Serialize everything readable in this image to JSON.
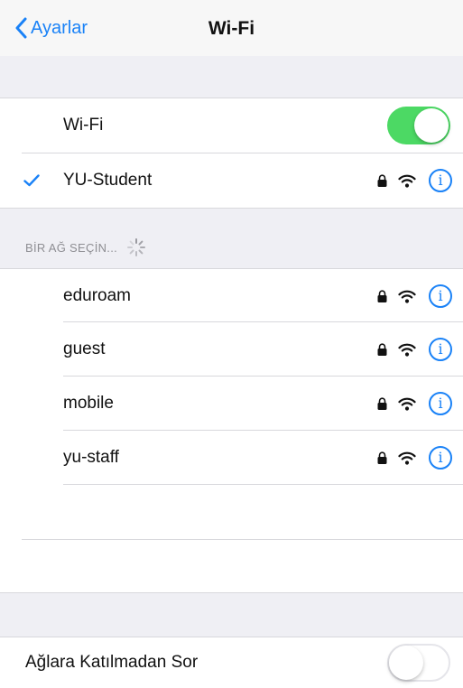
{
  "nav": {
    "back_label": "Ayarlar",
    "title": "Wi-Fi"
  },
  "wifi_toggle": {
    "label": "Wi-Fi",
    "state": "on"
  },
  "connected": {
    "name": "YU-Student",
    "secured": true
  },
  "section_header": "BİR AĞ SEÇİN...",
  "networks": [
    {
      "name": "eduroam",
      "secured": true
    },
    {
      "name": "guest",
      "secured": true
    },
    {
      "name": "mobile",
      "secured": true
    },
    {
      "name": "yu-staff",
      "secured": true
    }
  ],
  "ask_to_join": {
    "label": "Ağlara Katılmadan Sor",
    "state": "off"
  },
  "info_glyph": "i",
  "colors": {
    "accent": "#1a82f7",
    "toggle_on": "#4cd964",
    "group_bg": "#efeff4"
  }
}
